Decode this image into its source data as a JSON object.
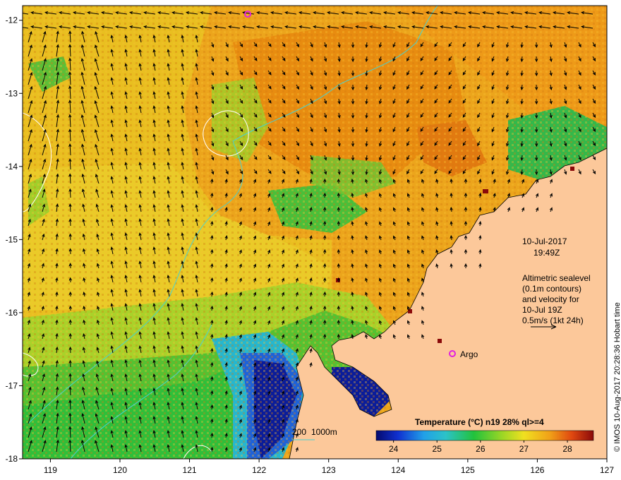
{
  "map": {
    "lon_ticks": [
      "119",
      "120",
      "121",
      "122",
      "123",
      "124",
      "125",
      "126",
      "127"
    ],
    "lat_ticks": [
      "-12",
      "-13",
      "-14",
      "-15",
      "-16",
      "-17",
      "-18"
    ],
    "lon_range": [
      118.6,
      127.0
    ],
    "lat_range": [
      -18.0,
      -11.8
    ],
    "colors": {
      "land": "#fcc89a",
      "warm": "#f0a020",
      "orange": "#e98a10",
      "yellow": "#e9c21c",
      "green": "#2cc13a",
      "lime": "#8fd32a",
      "cyan": "#27c3d7",
      "blue": "#1e3bd0",
      "navy": "#07148a",
      "contour_bathy": "#48d1d1",
      "contour_sealevel": "#ffffff"
    }
  },
  "annotation": {
    "date": "10-Jul-2017",
    "time": "19:49Z",
    "desc_lines": [
      "Altimetric sealevel",
      "(0.1m contours)",
      "and velocity for",
      "10-Jul 19Z",
      "0.5m/s (1kt 24h)"
    ]
  },
  "argo": {
    "label": "Argo"
  },
  "bathymetry_legend": {
    "label_200": "200",
    "label_1000": "1000m"
  },
  "colorbar": {
    "title": "Temperature (°C) n19 28% ql>=4",
    "ticks": [
      "24",
      "25",
      "26",
      "27",
      "28"
    ],
    "range": [
      23.6,
      28.6
    ]
  },
  "credit": "© IMOS 10-Aug-2017 20:28:36 Hobart time"
}
